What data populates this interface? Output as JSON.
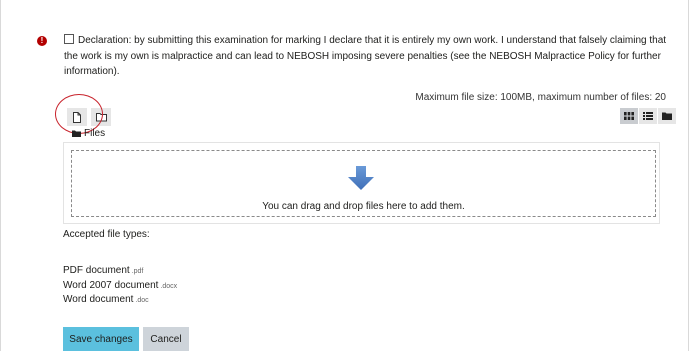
{
  "colors": {
    "required_icon": "#b30000",
    "highlight_ring": "#c8232c",
    "save_button": "#5bc0de",
    "cancel_button": "#ced4da",
    "upload_arrow": "#4a7cc4"
  },
  "required_icon": "!",
  "declaration": {
    "checked": false,
    "text": "Declaration: by submitting this examination for marking I declare that it is entirely my own work. I understand that falsely claiming that the work is my own is malpractice and can lead to NEBOSH imposing severe penalties (see the NEBOSH Malpractice Policy for further information)."
  },
  "filepicker": {
    "max_size_text": "Maximum file size: 100MB, maximum number of files: 20",
    "toolbar": {
      "add_file_icon": "file-icon",
      "create_folder_icon": "folder-plus-icon"
    },
    "view_modes": [
      "grid-icon",
      "list-icon",
      "folder-icon"
    ],
    "active_view": "grid-icon",
    "files_label": "Files",
    "dropzone_text": "You can drag and drop files here to add them."
  },
  "accepted": {
    "title": "Accepted file types:",
    "types": [
      {
        "name": "PDF document",
        "ext": ".pdf"
      },
      {
        "name": "Word 2007 document",
        "ext": ".docx"
      },
      {
        "name": "Word document",
        "ext": ".doc"
      }
    ]
  },
  "actions": {
    "save_label": "Save changes",
    "cancel_label": "Cancel"
  }
}
